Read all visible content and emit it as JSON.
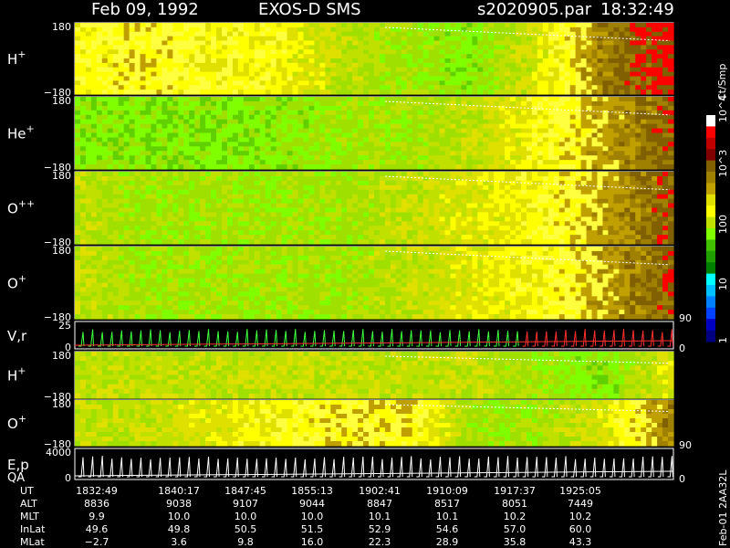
{
  "header": {
    "date": "Feb 09, 1992",
    "instrument": "EXOS-D SMS",
    "file": "s2020905.par",
    "time": "18:32:49"
  },
  "colorbar": {
    "unit_label": "Ct/Smp",
    "labels": [
      "10^4",
      "10^3",
      "100",
      "10",
      "1"
    ],
    "colors": [
      "#ffffff",
      "#ff0000",
      "#c00000",
      "#800000",
      "#806000",
      "#a08000",
      "#c0a000",
      "#e0e000",
      "#ffff00",
      "#c0e000",
      "#80ff00",
      "#40c000",
      "#20a000",
      "#008000",
      "#00ffff",
      "#00c0ff",
      "#0080ff",
      "#0040ff",
      "#0000c0",
      "#000080"
    ]
  },
  "panels": [
    {
      "id": "h-plus",
      "label": "H",
      "sup": "+",
      "ymax": "180",
      "ymin": "−180"
    },
    {
      "id": "he-plus",
      "label": "He",
      "sup": "+",
      "ymax": "180",
      "ymin": "−180"
    },
    {
      "id": "o-plusplus",
      "label": "O",
      "sup": "++",
      "ymax": "180",
      "ymin": "−180"
    },
    {
      "id": "o-plus",
      "label": "O",
      "sup": "+",
      "ymax": "180",
      "ymin": "−180",
      "right_label": "90"
    },
    {
      "id": "vr",
      "label": "V,r",
      "ymax": "25",
      "ymin": "0",
      "right_label": "0"
    },
    {
      "id": "h-plus-2",
      "label": "H",
      "sup": "+",
      "ymax": "180",
      "ymin": "−180"
    },
    {
      "id": "o-plus-2",
      "label": "O",
      "sup": "+",
      "ymax": "180",
      "ymin": "−180",
      "right_label": "90"
    },
    {
      "id": "ep",
      "label": "E,p",
      "label2": "QA",
      "ymax": "4000",
      "ymin": "0",
      "right_label": "0"
    }
  ],
  "side_note": "Feb-01 2AA32L",
  "ephemeris": {
    "rows": [
      {
        "name": "UT",
        "values": [
          "1832:49",
          "1840:17",
          "1847:45",
          "1855:13",
          "1902:41",
          "1910:09",
          "1917:37",
          "1925:05"
        ]
      },
      {
        "name": "ALT",
        "values": [
          "8836",
          "9038",
          "9107",
          "9044",
          "8847",
          "8517",
          "8051",
          "7449"
        ]
      },
      {
        "name": "MLT",
        "values": [
          "9.9",
          "10.0",
          "10.0",
          "10.0",
          "10.1",
          "10.1",
          "10.2",
          "10.2"
        ]
      },
      {
        "name": "InLat",
        "values": [
          "49.6",
          "49.8",
          "50.5",
          "51.5",
          "52.9",
          "54.6",
          "57.0",
          "60.0"
        ]
      },
      {
        "name": "MLat",
        "values": [
          "−2.7",
          "3.6",
          "9.8",
          "16.0",
          "22.3",
          "28.9",
          "35.8",
          "43.3"
        ]
      }
    ]
  },
  "chart_data": {
    "type": "heatmap",
    "x": [
      "1832:49",
      "1840:17",
      "1847:45",
      "1855:13",
      "1902:41",
      "1910:09",
      "1917:37",
      "1925:05"
    ],
    "colorbar_unit": "Ct/Smp",
    "colorbar_ticks": [
      1,
      10,
      100,
      1000,
      10000
    ],
    "series": [
      {
        "name": "H+",
        "ylim": [
          -180,
          180
        ],
        "levels": [
          14,
          15,
          14,
          14,
          12,
          11,
          10,
          13,
          17,
          19
        ]
      },
      {
        "name": "He+",
        "ylim": [
          -180,
          180
        ],
        "levels": [
          10,
          10,
          10,
          10,
          11,
          11,
          12,
          14,
          16,
          18
        ]
      },
      {
        "name": "O++",
        "ylim": [
          -180,
          180
        ],
        "levels": [
          12,
          11,
          11,
          11,
          11,
          12,
          13,
          14,
          16,
          18
        ]
      },
      {
        "name": "O+",
        "ylim": [
          -180,
          180
        ],
        "levels": [
          12,
          11,
          11,
          11,
          11,
          12,
          13,
          14,
          16,
          18
        ]
      },
      {
        "name": "V,r",
        "ylim": [
          0,
          25
        ]
      },
      {
        "name": "H+",
        "ylim": [
          -180,
          180
        ],
        "levels": [
          12,
          12,
          12,
          12,
          12,
          12,
          12,
          11,
          10,
          13
        ]
      },
      {
        "name": "O+",
        "ylim": [
          -180,
          180
        ],
        "levels": [
          12,
          12,
          13,
          14,
          15,
          15,
          11,
          11,
          13,
          17
        ]
      },
      {
        "name": "E,p",
        "ylim": [
          0,
          4000
        ]
      }
    ]
  }
}
